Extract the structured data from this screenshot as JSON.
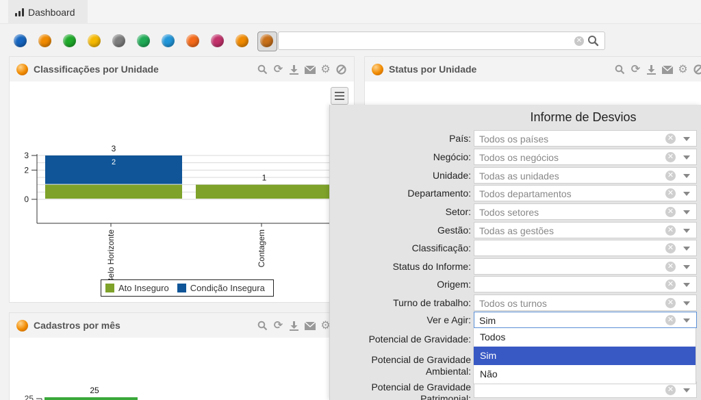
{
  "tab": {
    "label": "Dashboard",
    "icon": "bar-chart-icon"
  },
  "theme_dots": [
    "#1565c0",
    "#f08a00",
    "#1faa2a",
    "#f5b800",
    "#7d7d7d",
    "#1faa55",
    "#2196d9",
    "#f46a1a",
    "#c2326b",
    "#f08a00",
    "#c8701a"
  ],
  "search": {
    "value": "",
    "placeholder": ""
  },
  "panels": {
    "classificacoes": {
      "title": "Classificações por Unidade"
    },
    "status": {
      "title": "Status por Unidade"
    },
    "cadastros": {
      "title": "Cadastros por mês"
    }
  },
  "colors": {
    "ato": "#7ea22a",
    "condicao": "#0f5597",
    "cadastros": "#3aa83a"
  },
  "chart_data": {
    "type": "bar",
    "categories": [
      "Belo Horizonte",
      "Contagem"
    ],
    "series": [
      {
        "name": "Ato Inseguro",
        "values": [
          1,
          1
        ]
      },
      {
        "name": "Condição Insegura",
        "values": [
          2,
          0
        ]
      }
    ],
    "totals": [
      3,
      1
    ],
    "ylim": [
      0,
      3
    ],
    "yticks": [
      0,
      2,
      3
    ],
    "stacked": true,
    "legend": "bottom"
  },
  "cadastros_chart": {
    "value_label": "25",
    "tick": "25"
  },
  "form": {
    "title": "Informe de Desvios",
    "fields": [
      {
        "label": "País:",
        "value": "Todos os países"
      },
      {
        "label": "Negócio:",
        "value": "Todos os negócios"
      },
      {
        "label": "Unidade:",
        "value": "Todas as unidades"
      },
      {
        "label": "Departamento:",
        "value": "Todos departamentos"
      },
      {
        "label": "Setor:",
        "value": "Todos setores"
      },
      {
        "label": "Gestão:",
        "value": "Todas as gestões"
      },
      {
        "label": "Classificação:",
        "value": ""
      },
      {
        "label": "Status do Informe:",
        "value": ""
      },
      {
        "label": "Origem:",
        "value": ""
      },
      {
        "label": "Turno de trabalho:",
        "value": "Todos os turnos"
      },
      {
        "label": "Ver e Agir:",
        "value": "Sim"
      },
      {
        "label": "Potencial de Gravidade:",
        "value": ""
      },
      {
        "label": "Potencial de Gravidade Ambiental:",
        "value": ""
      },
      {
        "label": "Potencial de Gravidade Patrimonial:",
        "value": ""
      }
    ],
    "dropdown_options": [
      "Todos",
      "Sim",
      "Não"
    ],
    "dropdown_selected": "Sim"
  }
}
